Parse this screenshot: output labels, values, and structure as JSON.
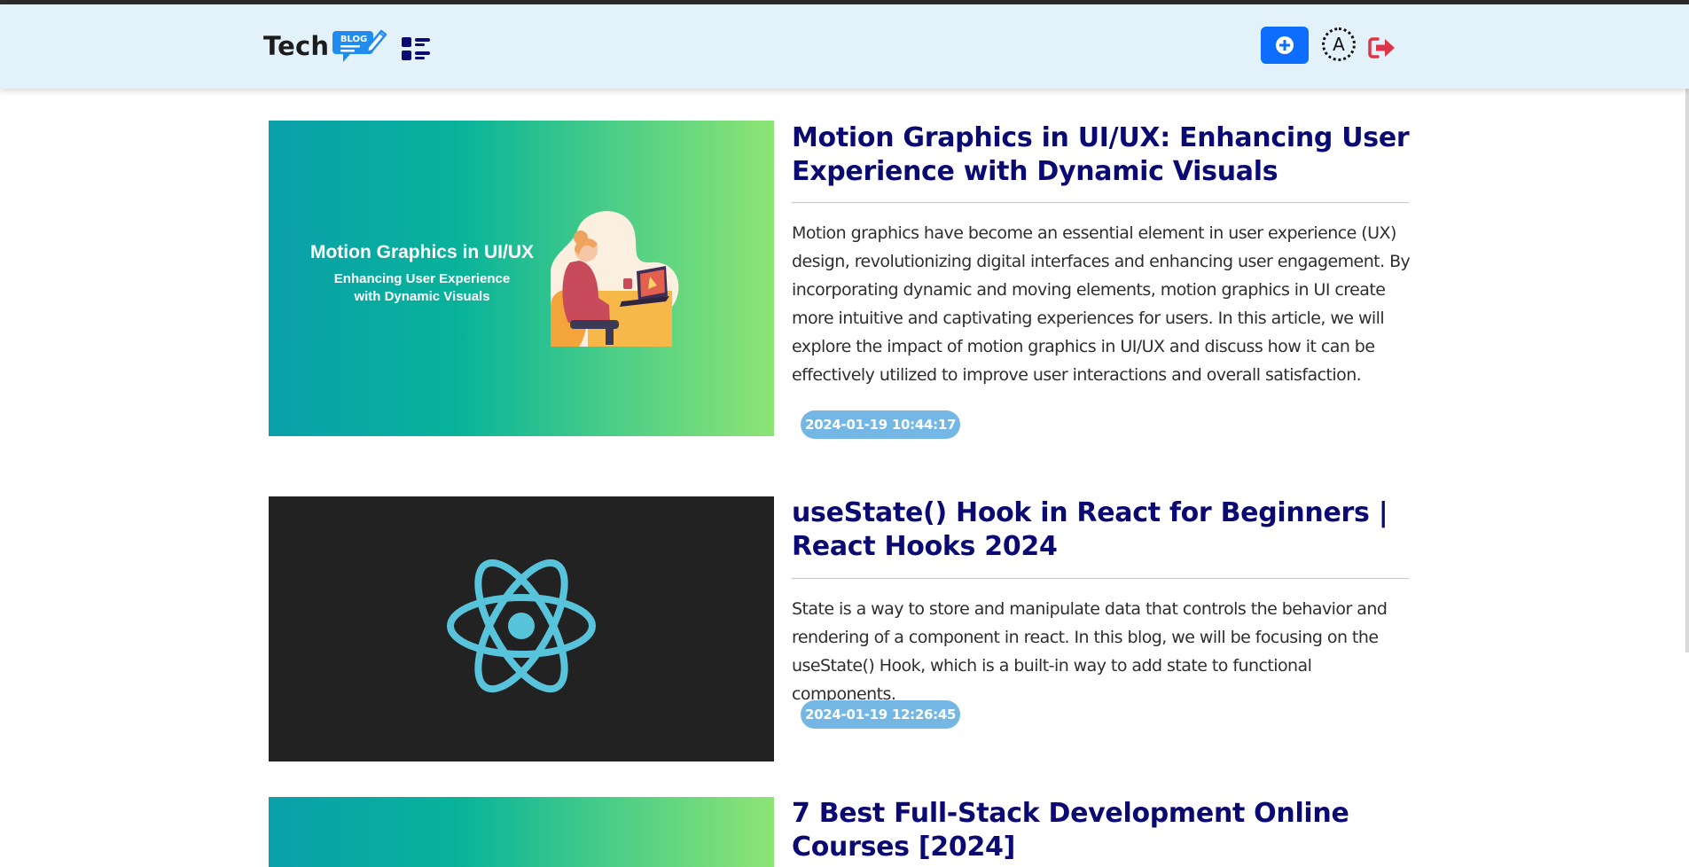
{
  "header": {
    "brand_text": "Tech",
    "brand_badge": "BLOG",
    "avatar_initial": "A"
  },
  "colors": {
    "navbar_bg": "#e3f1fb",
    "title": "#0a0a72",
    "add_button": "#0d6efd",
    "date_badge": "#74b6e4",
    "logout": "#dc3545",
    "menu_icon": "#0a0a72"
  },
  "icons": {
    "menu": "list-layout-icon",
    "add": "plus-circle-icon",
    "logout": "logout-icon"
  },
  "posts": [
    {
      "title": "Motion Graphics in UI/UX: Enhancing User Experience with Dynamic Visuals",
      "excerpt": "Motion graphics have become an essential element in user experience (UX) design, revolutionizing digital interfaces and enhancing user engagement. By incorporating dynamic and moving elements, motion graphics in UI create more intuitive and captivating experiences for users. In this article, we will explore the impact of motion graphics in UI/UX and discuss how it can be effectively utilized to improve user interactions and overall satisfaction.",
      "date": "2024-01-19 10:44:17",
      "image": {
        "heading": "Motion Graphics in UI/UX",
        "subheading_line1": "Enhancing User Experience",
        "subheading_line2": "with Dynamic Visuals"
      }
    },
    {
      "title": "useState() Hook in React for Beginners | React Hooks 2024",
      "excerpt": "State is a way to store and manipulate data that controls the behavior and rendering of a component in react. In this blog, we will be focusing on the useState() Hook, which is a built-in way to add state to functional components.",
      "date": "2024-01-19 12:26:45"
    },
    {
      "title": "7 Best Full-Stack Development Online Courses [2024]"
    }
  ]
}
